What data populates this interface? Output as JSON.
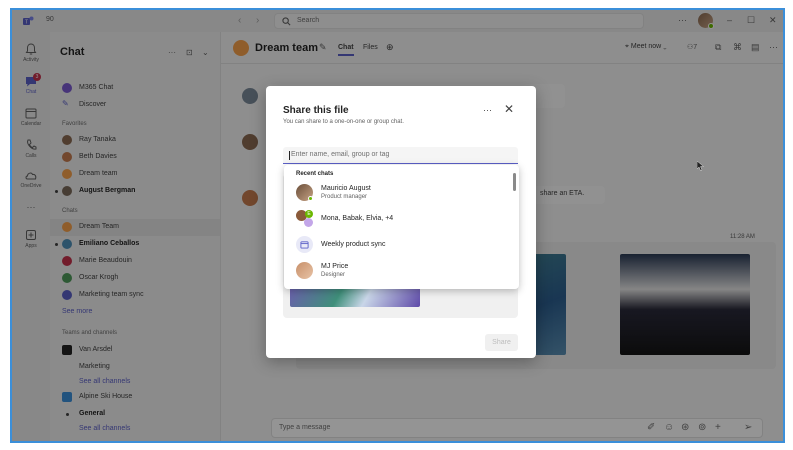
{
  "titlebar": {
    "count": "90",
    "search_placeholder": "Search",
    "more": "···",
    "minimize": "–",
    "maximize": "☐",
    "close": "✕"
  },
  "rail": [
    {
      "label": "Activity",
      "icon": "bell-icon"
    },
    {
      "label": "Chat",
      "icon": "chat-icon",
      "badge": "3"
    },
    {
      "label": "Calendar",
      "icon": "calendar-icon"
    },
    {
      "label": "Calls",
      "icon": "phone-icon"
    },
    {
      "label": "OneDrive",
      "icon": "cloud-icon"
    },
    {
      "label": "···",
      "icon": "more-icon"
    },
    {
      "label": "Apps",
      "icon": "apps-icon"
    }
  ],
  "sidebar": {
    "title": "Chat",
    "pinned": [
      {
        "name": "M365 Chat",
        "color": "#7a5bd1"
      },
      {
        "name": "Discover",
        "color": "#5b5fc7"
      }
    ],
    "favorites_label": "Favorites",
    "favorites": [
      {
        "name": "Ray Tanaka",
        "color": "#8a6a52",
        "bold": false
      },
      {
        "name": "Beth Davies",
        "color": "#c47a4f",
        "bold": false
      },
      {
        "name": "Dream team",
        "color": "#f7a14b",
        "bold": false
      },
      {
        "name": "August Bergman",
        "color": "#7b6a5a",
        "bold": true
      }
    ],
    "chats_label": "Chats",
    "chats": [
      {
        "name": "Dream Team",
        "color": "#f7a14b",
        "bold": false,
        "selected": true
      },
      {
        "name": "Emiliano Ceballos",
        "color": "#4f8fb8",
        "bold": true
      },
      {
        "name": "Marie Beaudouin",
        "color": "#c4314b",
        "bold": false
      },
      {
        "name": "Oscar Krogh",
        "color": "#4f9a5a",
        "bold": false
      },
      {
        "name": "Marketing team sync",
        "color": "#5b5fc7",
        "bold": false
      }
    ],
    "see_more": "See more",
    "teams_label": "Teams and channels",
    "teams": [
      {
        "name": "Van Arsdel",
        "color": "#242424"
      },
      {
        "name": "Marketing",
        "channel": true
      },
      {
        "name": "See all channels",
        "link": true
      },
      {
        "name": "Alpine Ski House",
        "color": "#3b8fd9"
      },
      {
        "name": "General",
        "channel": true,
        "bold": true
      },
      {
        "name": "See all channels",
        "link": true
      }
    ]
  },
  "header": {
    "title": "Dream team",
    "tabs": [
      "Chat",
      "Files"
    ],
    "meet_now": "Meet now",
    "participants": "7"
  },
  "conversation": {
    "eta_text": "share an ETA.",
    "timestamp": "11:28 AM"
  },
  "composer": {
    "placeholder": "Type a message"
  },
  "dialog": {
    "title": "Share this file",
    "subtitle": "You can share to a one-on-one or group chat.",
    "input_placeholder": "Enter name, email, group or tag",
    "share_label": "Share",
    "recent_label": "Recent chats",
    "recent": [
      {
        "name": "Mauricio August",
        "subtitle": "Product manager",
        "kind": "person",
        "color": "#8a6a52"
      },
      {
        "name": "Mona, Babak, Elvia, +4",
        "subtitle": "",
        "kind": "group",
        "color": "#b57a4f"
      },
      {
        "name": "Weekly product sync",
        "subtitle": "",
        "kind": "meeting",
        "color": "#e8e9f7"
      },
      {
        "name": "MJ Price",
        "subtitle": "Designer",
        "kind": "person",
        "color": "#c7906a"
      }
    ]
  },
  "colors": {
    "accent": "#5b5fc7",
    "presence": "#6bb700",
    "frame": "#3b8fd9"
  }
}
